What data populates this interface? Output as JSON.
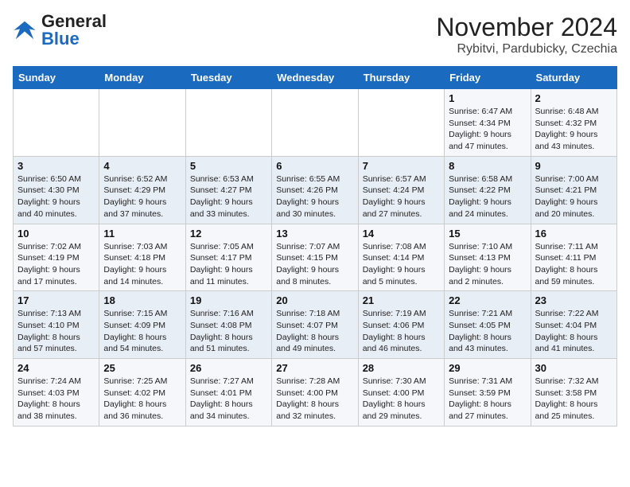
{
  "header": {
    "logo_general": "General",
    "logo_blue": "Blue",
    "title": "November 2024",
    "subtitle": "Rybitvi, Pardubicky, Czechia"
  },
  "weekdays": [
    "Sunday",
    "Monday",
    "Tuesday",
    "Wednesday",
    "Thursday",
    "Friday",
    "Saturday"
  ],
  "weeks": [
    [
      {
        "day": "",
        "info": ""
      },
      {
        "day": "",
        "info": ""
      },
      {
        "day": "",
        "info": ""
      },
      {
        "day": "",
        "info": ""
      },
      {
        "day": "",
        "info": ""
      },
      {
        "day": "1",
        "info": "Sunrise: 6:47 AM\nSunset: 4:34 PM\nDaylight: 9 hours and 47 minutes."
      },
      {
        "day": "2",
        "info": "Sunrise: 6:48 AM\nSunset: 4:32 PM\nDaylight: 9 hours and 43 minutes."
      }
    ],
    [
      {
        "day": "3",
        "info": "Sunrise: 6:50 AM\nSunset: 4:30 PM\nDaylight: 9 hours and 40 minutes."
      },
      {
        "day": "4",
        "info": "Sunrise: 6:52 AM\nSunset: 4:29 PM\nDaylight: 9 hours and 37 minutes."
      },
      {
        "day": "5",
        "info": "Sunrise: 6:53 AM\nSunset: 4:27 PM\nDaylight: 9 hours and 33 minutes."
      },
      {
        "day": "6",
        "info": "Sunrise: 6:55 AM\nSunset: 4:26 PM\nDaylight: 9 hours and 30 minutes."
      },
      {
        "day": "7",
        "info": "Sunrise: 6:57 AM\nSunset: 4:24 PM\nDaylight: 9 hours and 27 minutes."
      },
      {
        "day": "8",
        "info": "Sunrise: 6:58 AM\nSunset: 4:22 PM\nDaylight: 9 hours and 24 minutes."
      },
      {
        "day": "9",
        "info": "Sunrise: 7:00 AM\nSunset: 4:21 PM\nDaylight: 9 hours and 20 minutes."
      }
    ],
    [
      {
        "day": "10",
        "info": "Sunrise: 7:02 AM\nSunset: 4:19 PM\nDaylight: 9 hours and 17 minutes."
      },
      {
        "day": "11",
        "info": "Sunrise: 7:03 AM\nSunset: 4:18 PM\nDaylight: 9 hours and 14 minutes."
      },
      {
        "day": "12",
        "info": "Sunrise: 7:05 AM\nSunset: 4:17 PM\nDaylight: 9 hours and 11 minutes."
      },
      {
        "day": "13",
        "info": "Sunrise: 7:07 AM\nSunset: 4:15 PM\nDaylight: 9 hours and 8 minutes."
      },
      {
        "day": "14",
        "info": "Sunrise: 7:08 AM\nSunset: 4:14 PM\nDaylight: 9 hours and 5 minutes."
      },
      {
        "day": "15",
        "info": "Sunrise: 7:10 AM\nSunset: 4:13 PM\nDaylight: 9 hours and 2 minutes."
      },
      {
        "day": "16",
        "info": "Sunrise: 7:11 AM\nSunset: 4:11 PM\nDaylight: 8 hours and 59 minutes."
      }
    ],
    [
      {
        "day": "17",
        "info": "Sunrise: 7:13 AM\nSunset: 4:10 PM\nDaylight: 8 hours and 57 minutes."
      },
      {
        "day": "18",
        "info": "Sunrise: 7:15 AM\nSunset: 4:09 PM\nDaylight: 8 hours and 54 minutes."
      },
      {
        "day": "19",
        "info": "Sunrise: 7:16 AM\nSunset: 4:08 PM\nDaylight: 8 hours and 51 minutes."
      },
      {
        "day": "20",
        "info": "Sunrise: 7:18 AM\nSunset: 4:07 PM\nDaylight: 8 hours and 49 minutes."
      },
      {
        "day": "21",
        "info": "Sunrise: 7:19 AM\nSunset: 4:06 PM\nDaylight: 8 hours and 46 minutes."
      },
      {
        "day": "22",
        "info": "Sunrise: 7:21 AM\nSunset: 4:05 PM\nDaylight: 8 hours and 43 minutes."
      },
      {
        "day": "23",
        "info": "Sunrise: 7:22 AM\nSunset: 4:04 PM\nDaylight: 8 hours and 41 minutes."
      }
    ],
    [
      {
        "day": "24",
        "info": "Sunrise: 7:24 AM\nSunset: 4:03 PM\nDaylight: 8 hours and 38 minutes."
      },
      {
        "day": "25",
        "info": "Sunrise: 7:25 AM\nSunset: 4:02 PM\nDaylight: 8 hours and 36 minutes."
      },
      {
        "day": "26",
        "info": "Sunrise: 7:27 AM\nSunset: 4:01 PM\nDaylight: 8 hours and 34 minutes."
      },
      {
        "day": "27",
        "info": "Sunrise: 7:28 AM\nSunset: 4:00 PM\nDaylight: 8 hours and 32 minutes."
      },
      {
        "day": "28",
        "info": "Sunrise: 7:30 AM\nSunset: 4:00 PM\nDaylight: 8 hours and 29 minutes."
      },
      {
        "day": "29",
        "info": "Sunrise: 7:31 AM\nSunset: 3:59 PM\nDaylight: 8 hours and 27 minutes."
      },
      {
        "day": "30",
        "info": "Sunrise: 7:32 AM\nSunset: 3:58 PM\nDaylight: 8 hours and 25 minutes."
      }
    ]
  ]
}
